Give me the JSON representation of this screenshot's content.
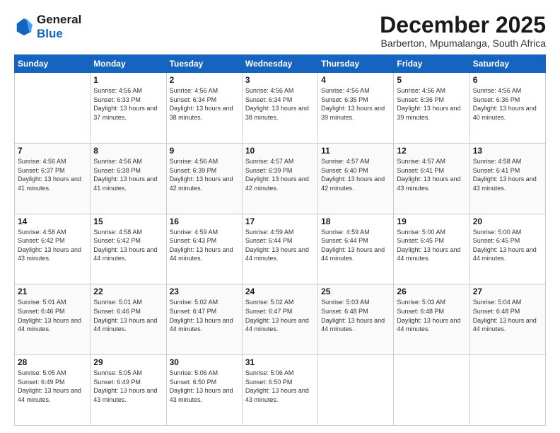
{
  "header": {
    "logo_line1": "General",
    "logo_line2": "Blue",
    "month": "December 2025",
    "location": "Barberton, Mpumalanga, South Africa"
  },
  "weekdays": [
    "Sunday",
    "Monday",
    "Tuesday",
    "Wednesday",
    "Thursday",
    "Friday",
    "Saturday"
  ],
  "weeks": [
    [
      {
        "day": "",
        "sunrise": "",
        "sunset": "",
        "daylight": ""
      },
      {
        "day": "1",
        "sunrise": "Sunrise: 4:56 AM",
        "sunset": "Sunset: 6:33 PM",
        "daylight": "Daylight: 13 hours and 37 minutes."
      },
      {
        "day": "2",
        "sunrise": "Sunrise: 4:56 AM",
        "sunset": "Sunset: 6:34 PM",
        "daylight": "Daylight: 13 hours and 38 minutes."
      },
      {
        "day": "3",
        "sunrise": "Sunrise: 4:56 AM",
        "sunset": "Sunset: 6:34 PM",
        "daylight": "Daylight: 13 hours and 38 minutes."
      },
      {
        "day": "4",
        "sunrise": "Sunrise: 4:56 AM",
        "sunset": "Sunset: 6:35 PM",
        "daylight": "Daylight: 13 hours and 39 minutes."
      },
      {
        "day": "5",
        "sunrise": "Sunrise: 4:56 AM",
        "sunset": "Sunset: 6:36 PM",
        "daylight": "Daylight: 13 hours and 39 minutes."
      },
      {
        "day": "6",
        "sunrise": "Sunrise: 4:56 AM",
        "sunset": "Sunset: 6:36 PM",
        "daylight": "Daylight: 13 hours and 40 minutes."
      }
    ],
    [
      {
        "day": "7",
        "sunrise": "Sunrise: 4:56 AM",
        "sunset": "Sunset: 6:37 PM",
        "daylight": "Daylight: 13 hours and 41 minutes."
      },
      {
        "day": "8",
        "sunrise": "Sunrise: 4:56 AM",
        "sunset": "Sunset: 6:38 PM",
        "daylight": "Daylight: 13 hours and 41 minutes."
      },
      {
        "day": "9",
        "sunrise": "Sunrise: 4:56 AM",
        "sunset": "Sunset: 6:39 PM",
        "daylight": "Daylight: 13 hours and 42 minutes."
      },
      {
        "day": "10",
        "sunrise": "Sunrise: 4:57 AM",
        "sunset": "Sunset: 6:39 PM",
        "daylight": "Daylight: 13 hours and 42 minutes."
      },
      {
        "day": "11",
        "sunrise": "Sunrise: 4:57 AM",
        "sunset": "Sunset: 6:40 PM",
        "daylight": "Daylight: 13 hours and 42 minutes."
      },
      {
        "day": "12",
        "sunrise": "Sunrise: 4:57 AM",
        "sunset": "Sunset: 6:41 PM",
        "daylight": "Daylight: 13 hours and 43 minutes."
      },
      {
        "day": "13",
        "sunrise": "Sunrise: 4:58 AM",
        "sunset": "Sunset: 6:41 PM",
        "daylight": "Daylight: 13 hours and 43 minutes."
      }
    ],
    [
      {
        "day": "14",
        "sunrise": "Sunrise: 4:58 AM",
        "sunset": "Sunset: 6:42 PM",
        "daylight": "Daylight: 13 hours and 43 minutes."
      },
      {
        "day": "15",
        "sunrise": "Sunrise: 4:58 AM",
        "sunset": "Sunset: 6:42 PM",
        "daylight": "Daylight: 13 hours and 44 minutes."
      },
      {
        "day": "16",
        "sunrise": "Sunrise: 4:59 AM",
        "sunset": "Sunset: 6:43 PM",
        "daylight": "Daylight: 13 hours and 44 minutes."
      },
      {
        "day": "17",
        "sunrise": "Sunrise: 4:59 AM",
        "sunset": "Sunset: 6:44 PM",
        "daylight": "Daylight: 13 hours and 44 minutes."
      },
      {
        "day": "18",
        "sunrise": "Sunrise: 4:59 AM",
        "sunset": "Sunset: 6:44 PM",
        "daylight": "Daylight: 13 hours and 44 minutes."
      },
      {
        "day": "19",
        "sunrise": "Sunrise: 5:00 AM",
        "sunset": "Sunset: 6:45 PM",
        "daylight": "Daylight: 13 hours and 44 minutes."
      },
      {
        "day": "20",
        "sunrise": "Sunrise: 5:00 AM",
        "sunset": "Sunset: 6:45 PM",
        "daylight": "Daylight: 13 hours and 44 minutes."
      }
    ],
    [
      {
        "day": "21",
        "sunrise": "Sunrise: 5:01 AM",
        "sunset": "Sunset: 6:46 PM",
        "daylight": "Daylight: 13 hours and 44 minutes."
      },
      {
        "day": "22",
        "sunrise": "Sunrise: 5:01 AM",
        "sunset": "Sunset: 6:46 PM",
        "daylight": "Daylight: 13 hours and 44 minutes."
      },
      {
        "day": "23",
        "sunrise": "Sunrise: 5:02 AM",
        "sunset": "Sunset: 6:47 PM",
        "daylight": "Daylight: 13 hours and 44 minutes."
      },
      {
        "day": "24",
        "sunrise": "Sunrise: 5:02 AM",
        "sunset": "Sunset: 6:47 PM",
        "daylight": "Daylight: 13 hours and 44 minutes."
      },
      {
        "day": "25",
        "sunrise": "Sunrise: 5:03 AM",
        "sunset": "Sunset: 6:48 PM",
        "daylight": "Daylight: 13 hours and 44 minutes."
      },
      {
        "day": "26",
        "sunrise": "Sunrise: 5:03 AM",
        "sunset": "Sunset: 6:48 PM",
        "daylight": "Daylight: 13 hours and 44 minutes."
      },
      {
        "day": "27",
        "sunrise": "Sunrise: 5:04 AM",
        "sunset": "Sunset: 6:48 PM",
        "daylight": "Daylight: 13 hours and 44 minutes."
      }
    ],
    [
      {
        "day": "28",
        "sunrise": "Sunrise: 5:05 AM",
        "sunset": "Sunset: 6:49 PM",
        "daylight": "Daylight: 13 hours and 44 minutes."
      },
      {
        "day": "29",
        "sunrise": "Sunrise: 5:05 AM",
        "sunset": "Sunset: 6:49 PM",
        "daylight": "Daylight: 13 hours and 43 minutes."
      },
      {
        "day": "30",
        "sunrise": "Sunrise: 5:06 AM",
        "sunset": "Sunset: 6:50 PM",
        "daylight": "Daylight: 13 hours and 43 minutes."
      },
      {
        "day": "31",
        "sunrise": "Sunrise: 5:06 AM",
        "sunset": "Sunset: 6:50 PM",
        "daylight": "Daylight: 13 hours and 43 minutes."
      },
      {
        "day": "",
        "sunrise": "",
        "sunset": "",
        "daylight": ""
      },
      {
        "day": "",
        "sunrise": "",
        "sunset": "",
        "daylight": ""
      },
      {
        "day": "",
        "sunrise": "",
        "sunset": "",
        "daylight": ""
      }
    ]
  ]
}
